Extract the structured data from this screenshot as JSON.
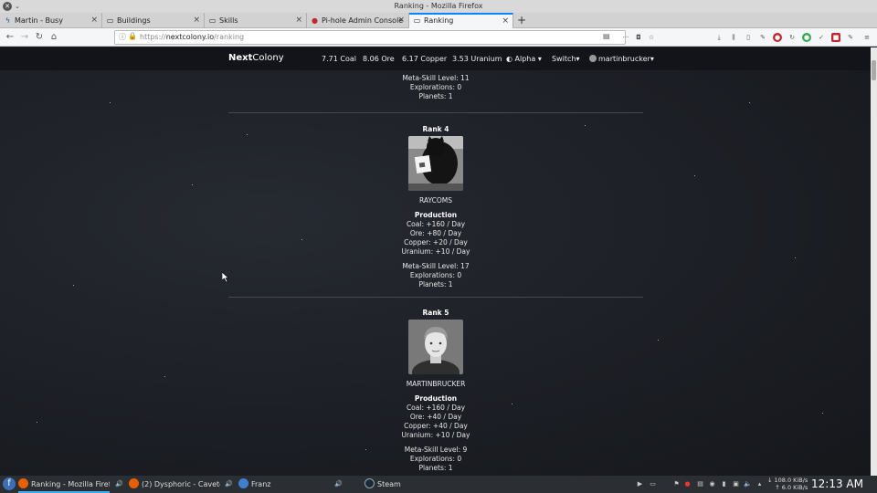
{
  "window": {
    "title": "Ranking - Mozilla Firefox"
  },
  "tabs": [
    {
      "label": "Martin - Busy",
      "icon": "steem-icon"
    },
    {
      "label": "Buildings",
      "icon": "page-icon"
    },
    {
      "label": "Skills",
      "icon": "page-icon"
    },
    {
      "label": "Pi-hole Admin Console",
      "icon": "pihole-icon"
    },
    {
      "label": "Ranking",
      "icon": "page-icon",
      "active": true
    }
  ],
  "url": {
    "prefix": "https://",
    "host": "nextcolony.io",
    "path": "/ranking"
  },
  "site": {
    "brand_bold": "Next",
    "brand_rest": "Colony",
    "resources": [
      "7.71 Coal",
      "8.06 Ore",
      "6.17 Copper",
      "3.53 Uranium"
    ],
    "planet_menu": "Alpha",
    "switch_menu": "Switch",
    "user_menu": "martinbrucker"
  },
  "ranking": [
    {
      "meta_skill": "Meta-Skill Level: 11",
      "explorations": "Explorations: 0",
      "planets": "Planets: 1"
    },
    {
      "rank": "Rank 4",
      "name": "RAYCOMS",
      "production_title": "Production",
      "coal": "Coal: +160 / Day",
      "ore": "Ore: +80 / Day",
      "copper": "Copper: +20 / Day",
      "uranium": "Uranium: +10 / Day",
      "meta_skill": "Meta-Skill Level: 17",
      "explorations": "Explorations: 0",
      "planets": "Planets: 1"
    },
    {
      "rank": "Rank 5",
      "name": "MARTINBRUCKER",
      "production_title": "Production",
      "coal": "Coal: +160 / Day",
      "ore": "Ore: +40 / Day",
      "copper": "Copper: +40 / Day",
      "uranium": "Uranium: +10 / Day",
      "meta_skill": "Meta-Skill Level: 9",
      "explorations": "Explorations: 0",
      "planets": "Planets: 1"
    }
  ],
  "taskbar": {
    "tasks": [
      "Ranking - Mozilla Firefox",
      "(2) Dysphoric - Cavetow...",
      "Franz",
      "Steam"
    ],
    "net_down": "↓ 108.0 KiB/s",
    "net_up": "↑ 6.0 KiB/s",
    "clock": "12:13 AM"
  }
}
